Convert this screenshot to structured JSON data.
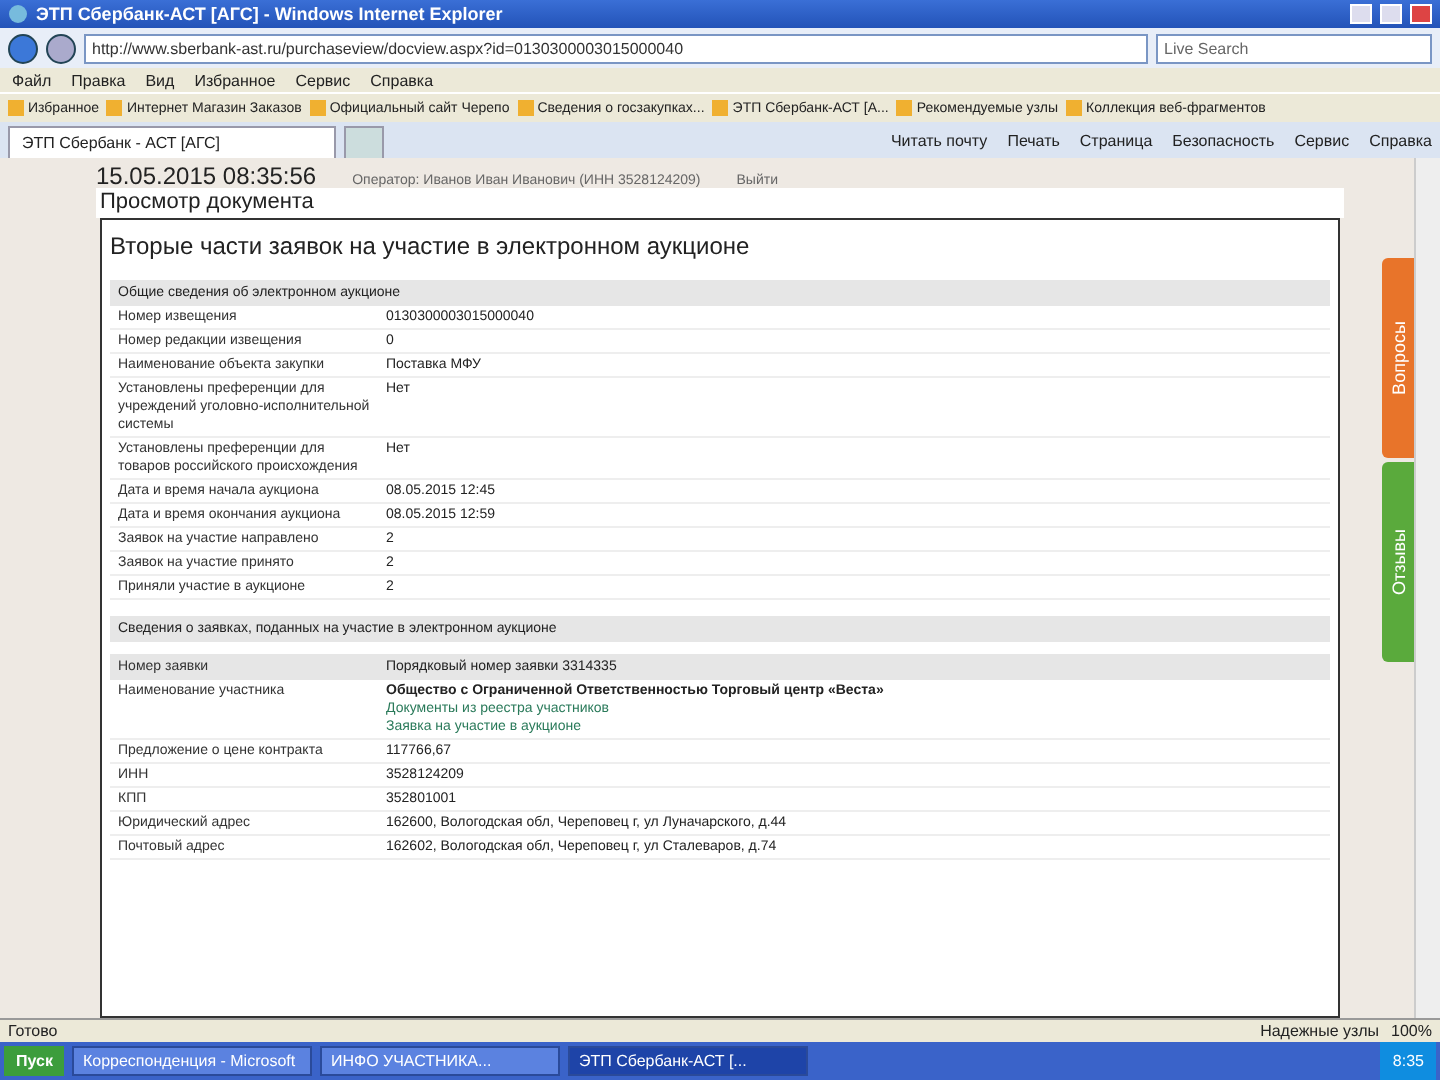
{
  "window": {
    "title": "ЭТП Сбербанк-АСТ [АГС] - Windows Internet Explorer"
  },
  "address_bar": {
    "url": "http://www.sberbank-ast.ru/purchaseview/docview.aspx?id=0130300003015000040"
  },
  "search": {
    "placeholder": "Live Search"
  },
  "menu": [
    "Файл",
    "Правка",
    "Вид",
    "Избранное",
    "Сервис",
    "Справка"
  ],
  "favorites": [
    "Избранное",
    "Интернет Магазин Заказов",
    "Официальный сайт Черепо",
    "Сведения о госзакупках...",
    "ЭТП Сбербанк-АСТ [А...",
    "Рекомендуемые узлы",
    "Коллекция веб-фрагментов"
  ],
  "tab": {
    "label": "ЭТП Сбербанк - АСТ [АГС]"
  },
  "commands": [
    "Читать почту",
    "Печать",
    "Страница",
    "Безопасность",
    "Сервис",
    "Справка"
  ],
  "page": {
    "datetime": "15.05.2015 08:35:56",
    "operator": "Оператор: Иванов Иван Иванович (ИНН 3528124209)",
    "logout": "Выйти",
    "heading": "Просмотр документа",
    "title": "Вторые части заявок на участие в электронном аукционе",
    "general": {
      "title": "Общие сведения об электронном аукционе",
      "rows": [
        {
          "label": "Номер извещения",
          "value": "0130300003015000040"
        },
        {
          "label": "Номер редакции извещения",
          "value": "0"
        },
        {
          "label": "Наименование объекта закупки",
          "value": "Поставка МФУ"
        },
        {
          "label": "Установлены преференции для учреждений уголовно-исполнительной системы",
          "value": "Нет"
        },
        {
          "label": "Установлены преференции для товаров российского происхождения",
          "value": "Нет"
        },
        {
          "label": "Дата и время начала аукциона",
          "value": "08.05.2015 12:45"
        },
        {
          "label": "Дата и время окончания аукциона",
          "value": "08.05.2015 12:59"
        },
        {
          "label": "Заявок на участие направлено",
          "value": "2"
        },
        {
          "label": "Заявок на участие принято",
          "value": "2"
        },
        {
          "label": "Приняли участие в аукционе",
          "value": "2"
        }
      ]
    },
    "applications": {
      "title": "Сведения о заявках, поданных на участие в электронном аукционе",
      "header": {
        "label": "Номер заявки",
        "value": "Порядковый номер заявки 3314335"
      },
      "rows": [
        {
          "label": "Наименование участника",
          "values": [
            {
              "kind": "bold",
              "text": "Общество с Ограниченной Ответственностью Торговый центр «Веста»"
            },
            {
              "kind": "link",
              "text": "Документы из реестра участников"
            },
            {
              "kind": "link",
              "text": "Заявка на участие в аукционе"
            }
          ]
        },
        {
          "label": "Предложение о цене контракта",
          "values": [
            {
              "kind": "text",
              "text": "117766,67"
            }
          ]
        },
        {
          "label": "ИНН",
          "values": [
            {
              "kind": "text",
              "text": "3528124209"
            }
          ]
        },
        {
          "label": "КПП",
          "values": [
            {
              "kind": "text",
              "text": "352801001"
            }
          ]
        },
        {
          "label": "Юридический адрес",
          "values": [
            {
              "kind": "text",
              "text": "162600, Вологодская обл, Череповец г, ул Луначарского, д.44"
            }
          ]
        },
        {
          "label": "Почтовый адрес",
          "values": [
            {
              "kind": "text",
              "text": "162602, Вологодская обл, Череповец г, ул Сталеваров, д.74"
            }
          ]
        }
      ]
    }
  },
  "side_tabs": [
    {
      "label": "Вопросы",
      "color": "#e8742a"
    },
    {
      "label": "Отзывы",
      "color": "#5aaa3c"
    }
  ],
  "status_bar": {
    "text": "Готово",
    "zone": "Надежные узлы",
    "zoom": "100%"
  },
  "taskbar": {
    "start": "Пуск",
    "items": [
      {
        "label": "Корреспонденция - Microsoft",
        "selected": false
      },
      {
        "label": "ИНФО УЧАСТНИКА...",
        "selected": false
      },
      {
        "label": "ЭТП Сбербанк-АСТ [...",
        "selected": true
      }
    ],
    "clock": "8:35"
  }
}
